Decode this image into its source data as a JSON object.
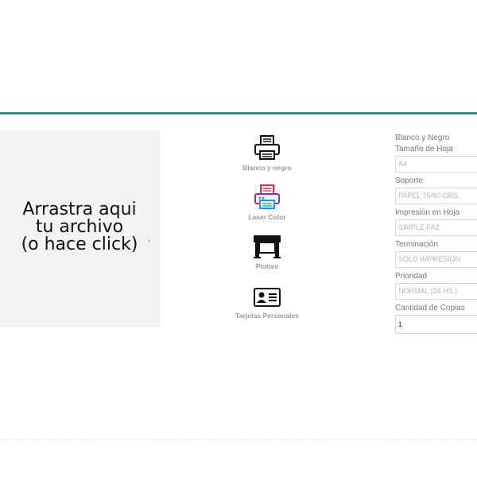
{
  "upload": {
    "text": "Arrastra aqui\ntu archivo\n(o hace click)",
    "mark": ","
  },
  "print_options": [
    {
      "label": "Blanco y negro",
      "icon": "printer-icon"
    },
    {
      "label": "Laser Color",
      "icon": "color-printer-icon"
    },
    {
      "label": "Plotteo",
      "icon": "plotter-icon"
    },
    {
      "label": "Tarjetas Personales",
      "icon": "id-card-icon"
    }
  ],
  "summary": {
    "heading": "Blanco y Negro",
    "fields": [
      {
        "label": "Tamaño de Hoja",
        "value": "A4"
      },
      {
        "label": "Soporte",
        "value": "PAPEL 75/80 GRS."
      },
      {
        "label": "Impresión en Hoja",
        "value": "SIMPLE FAZ"
      },
      {
        "label": "Terminación",
        "value": "SOLO IMPRESION"
      },
      {
        "label": "Prioridad",
        "value": "NORMAL (24 HS.)"
      },
      {
        "label": "Cantidad de Copias",
        "value": "1"
      }
    ]
  },
  "colors": {
    "accent": "#1e9a8f"
  }
}
